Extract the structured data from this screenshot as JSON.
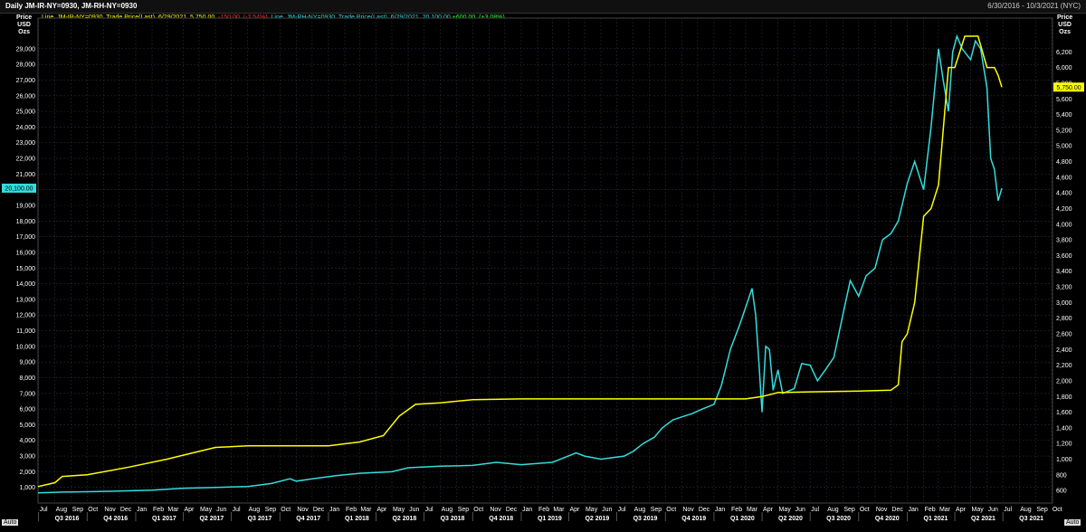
{
  "header": {
    "title": "Daily JM-IR-NY=0930, JM-RH-NY=0930",
    "date_range": "6/30/2016 - 10/3/2021 (NYC)"
  },
  "legend": {
    "ir_text": "Line, JM-IR-NY=0930, Trade Price(Last), 6/29/2021, 5,750.00,",
    "ir_change": "-150.00, (-2.54%),",
    "rh_text": "Line, JM-RH-NY=0930, Trade Price(Last), 6/29/2021, 20,100.00",
    "rh_change": "+600.00, (+3.08%)"
  },
  "axis_titles": {
    "left": [
      "Price",
      "USD",
      "Ozs"
    ],
    "right": [
      "Price",
      "USD",
      "Ozs"
    ]
  },
  "auto_label_left": "Auto",
  "auto_label_right": "Auto",
  "chart_data": {
    "type": "line",
    "colors": {
      "rhodium": "#33dddd",
      "iridium": "#ffff00",
      "grid": "#2a2a3a"
    },
    "left_axis": {
      "ticks": [
        1000,
        2000,
        3000,
        4000,
        5000,
        6000,
        7000,
        8000,
        9000,
        10000,
        11000,
        12000,
        13000,
        14000,
        15000,
        16000,
        17000,
        18000,
        19000,
        20000,
        21000,
        22000,
        23000,
        24000,
        25000,
        26000,
        27000,
        28000,
        29000
      ],
      "tick_labels": [
        "1,000",
        "2,000",
        "3,000",
        "4,000",
        "5,000",
        "6,000",
        "7,000",
        "8,000",
        "9,000",
        "10,000",
        "11,000",
        "12,000",
        "13,000",
        "14,000",
        "15,000",
        "16,000",
        "17,000",
        "18,000",
        "19,000",
        "20,000",
        "21,000",
        "22,000",
        "23,000",
        "24,000",
        "25,000",
        "26,000",
        "27,000",
        "28,000",
        "29,000"
      ],
      "range": [
        0,
        29800
      ]
    },
    "right_axis": {
      "ticks": [
        600,
        800,
        1000,
        1200,
        1400,
        1600,
        1800,
        2000,
        2200,
        2400,
        2600,
        2800,
        3000,
        3200,
        3400,
        3600,
        3800,
        4000,
        4200,
        4400,
        4600,
        4800,
        5000,
        5200,
        5400,
        5600,
        5800,
        6000,
        6200
      ],
      "tick_labels": [
        "600",
        "800",
        "1,000",
        "1,200",
        "1,400",
        "1,600",
        "1,800",
        "2,000",
        "2,200",
        "2,400",
        "2,600",
        "2,800",
        "3,000",
        "3,200",
        "3,400",
        "3,600",
        "3,800",
        "4,000",
        "4,200",
        "4,400",
        "4,600",
        "4,800",
        "5,000",
        "5,200",
        "5,400",
        "5,600",
        "5,800",
        "6,000",
        "6,200"
      ],
      "range": [
        440,
        6400
      ]
    },
    "x_range": [
      "2016-06-30",
      "2021-10-03"
    ],
    "months": [
      "Jul",
      "Aug",
      "Sep",
      "Oct",
      "Nov",
      "Dec",
      "Jan",
      "Feb",
      "Mar",
      "Apr",
      "May",
      "Jun",
      "Jul",
      "Aug",
      "Sep",
      "Oct",
      "Nov",
      "Dec",
      "Jan",
      "Feb",
      "Mar",
      "Apr",
      "May",
      "Jun",
      "Jul",
      "Aug",
      "Sep",
      "Oct",
      "Nov",
      "Dec",
      "Jan",
      "Feb",
      "Mar",
      "Apr",
      "May",
      "Jun",
      "Jul",
      "Aug",
      "Sep",
      "Oct",
      "Nov",
      "Dec",
      "Jan",
      "Feb",
      "Mar",
      "Apr",
      "May",
      "Jun",
      "Jul",
      "Aug",
      "Sep",
      "Oct",
      "Nov",
      "Dec",
      "Jan",
      "Feb",
      "Mar",
      "Apr",
      "May",
      "Jun",
      "Jul",
      "Aug",
      "Sep",
      "Oct"
    ],
    "quarters": [
      "Q3 2016",
      "Q4 2016",
      "Q1 2017",
      "Q2 2017",
      "Q3 2017",
      "Q4 2017",
      "Q1 2018",
      "Q2 2018",
      "Q3 2018",
      "Q4 2018",
      "Q1 2019",
      "Q2 2019",
      "Q3 2019",
      "Q4 2019",
      "Q1 2020",
      "Q2 2020",
      "Q3 2020",
      "Q4 2020",
      "Q1 2021",
      "Q2 2021",
      "Q3 2021"
    ],
    "last_value_tags": [
      {
        "series": "rhodium",
        "label": "20,100.00",
        "value": 20100,
        "axis": "left"
      },
      {
        "series": "iridium",
        "label": "5,750.00",
        "value": 5750,
        "axis": "right"
      }
    ],
    "series": [
      {
        "key": "rhodium",
        "axis": "left",
        "points": [
          [
            "2016-06-30",
            650
          ],
          [
            "2016-08-15",
            700
          ],
          [
            "2016-10-01",
            720
          ],
          [
            "2016-12-01",
            760
          ],
          [
            "2017-02-01",
            820
          ],
          [
            "2017-04-01",
            950
          ],
          [
            "2017-06-01",
            1000
          ],
          [
            "2017-08-01",
            1050
          ],
          [
            "2017-09-15",
            1250
          ],
          [
            "2017-10-20",
            1550
          ],
          [
            "2017-11-01",
            1400
          ],
          [
            "2017-12-01",
            1550
          ],
          [
            "2018-01-15",
            1750
          ],
          [
            "2018-03-01",
            1900
          ],
          [
            "2018-05-01",
            2000
          ],
          [
            "2018-06-01",
            2250
          ],
          [
            "2018-08-01",
            2350
          ],
          [
            "2018-10-01",
            2400
          ],
          [
            "2018-11-15",
            2600
          ],
          [
            "2019-01-01",
            2450
          ],
          [
            "2019-03-01",
            2600
          ],
          [
            "2019-04-15",
            3200
          ],
          [
            "2019-05-01",
            3000
          ],
          [
            "2019-06-01",
            2800
          ],
          [
            "2019-07-15",
            3000
          ],
          [
            "2019-08-01",
            3300
          ],
          [
            "2019-08-20",
            3800
          ],
          [
            "2019-09-10",
            4200
          ],
          [
            "2019-09-25",
            4800
          ],
          [
            "2019-10-15",
            5300
          ],
          [
            "2019-11-01",
            5500
          ],
          [
            "2019-11-20",
            5700
          ],
          [
            "2019-12-10",
            6000
          ],
          [
            "2020-01-01",
            6300
          ],
          [
            "2020-01-15",
            7500
          ],
          [
            "2020-02-01",
            9800
          ],
          [
            "2020-02-20",
            11500
          ],
          [
            "2020-03-05",
            12900
          ],
          [
            "2020-03-13",
            13700
          ],
          [
            "2020-03-20",
            12000
          ],
          [
            "2020-03-27",
            8500
          ],
          [
            "2020-04-01",
            5800
          ],
          [
            "2020-04-08",
            10000
          ],
          [
            "2020-04-15",
            9800
          ],
          [
            "2020-04-22",
            7200
          ],
          [
            "2020-05-01",
            8500
          ],
          [
            "2020-05-10",
            7000
          ],
          [
            "2020-06-01",
            7300
          ],
          [
            "2020-06-15",
            8900
          ],
          [
            "2020-07-01",
            8800
          ],
          [
            "2020-07-15",
            7800
          ],
          [
            "2020-08-01",
            8600
          ],
          [
            "2020-08-15",
            9300
          ],
          [
            "2020-09-01",
            12000
          ],
          [
            "2020-09-15",
            14200
          ],
          [
            "2020-10-01",
            13200
          ],
          [
            "2020-10-15",
            14500
          ],
          [
            "2020-11-01",
            15000
          ],
          [
            "2020-11-15",
            16800
          ],
          [
            "2020-12-01",
            17200
          ],
          [
            "2020-12-15",
            18000
          ],
          [
            "2021-01-01",
            20400
          ],
          [
            "2021-01-15",
            21800
          ],
          [
            "2021-02-01",
            20000
          ],
          [
            "2021-02-15",
            24000
          ],
          [
            "2021-03-01",
            29000
          ],
          [
            "2021-03-10",
            27000
          ],
          [
            "2021-03-20",
            25000
          ],
          [
            "2021-03-28",
            28800
          ],
          [
            "2021-04-05",
            29800
          ],
          [
            "2021-04-15",
            29000
          ],
          [
            "2021-05-01",
            28300
          ],
          [
            "2021-05-10",
            29500
          ],
          [
            "2021-05-20",
            29000
          ],
          [
            "2021-06-01",
            26500
          ],
          [
            "2021-06-08",
            22000
          ],
          [
            "2021-06-15",
            21300
          ],
          [
            "2021-06-22",
            19300
          ],
          [
            "2021-06-29",
            20100
          ]
        ]
      },
      {
        "key": "iridium",
        "axis": "right",
        "points": [
          [
            "2016-06-30",
            650
          ],
          [
            "2016-08-01",
            700
          ],
          [
            "2016-08-15",
            780
          ],
          [
            "2016-10-01",
            800
          ],
          [
            "2016-12-20",
            900
          ],
          [
            "2017-03-01",
            1000
          ],
          [
            "2017-05-01",
            1100
          ],
          [
            "2017-06-01",
            1150
          ],
          [
            "2017-08-01",
            1170
          ],
          [
            "2018-01-01",
            1170
          ],
          [
            "2018-03-01",
            1220
          ],
          [
            "2018-04-15",
            1300
          ],
          [
            "2018-05-15",
            1550
          ],
          [
            "2018-06-15",
            1700
          ],
          [
            "2018-08-01",
            1720
          ],
          [
            "2018-10-01",
            1760
          ],
          [
            "2019-01-01",
            1770
          ],
          [
            "2019-09-01",
            1770
          ],
          [
            "2019-12-01",
            1770
          ],
          [
            "2020-03-01",
            1770
          ],
          [
            "2020-04-01",
            1800
          ],
          [
            "2020-05-01",
            1850
          ],
          [
            "2020-07-01",
            1860
          ],
          [
            "2020-10-01",
            1870
          ],
          [
            "2020-12-01",
            1880
          ],
          [
            "2020-12-15",
            1950
          ],
          [
            "2020-12-22",
            2500
          ],
          [
            "2021-01-01",
            2600
          ],
          [
            "2021-01-15",
            3000
          ],
          [
            "2021-02-01",
            4100
          ],
          [
            "2021-02-15",
            4200
          ],
          [
            "2021-03-01",
            4500
          ],
          [
            "2021-03-10",
            5200
          ],
          [
            "2021-03-20",
            6000
          ],
          [
            "2021-04-01",
            6000
          ],
          [
            "2021-04-20",
            6400
          ],
          [
            "2021-05-15",
            6400
          ],
          [
            "2021-06-01",
            6000
          ],
          [
            "2021-06-15",
            6000
          ],
          [
            "2021-06-22",
            5900
          ],
          [
            "2021-06-29",
            5750
          ]
        ]
      }
    ]
  }
}
